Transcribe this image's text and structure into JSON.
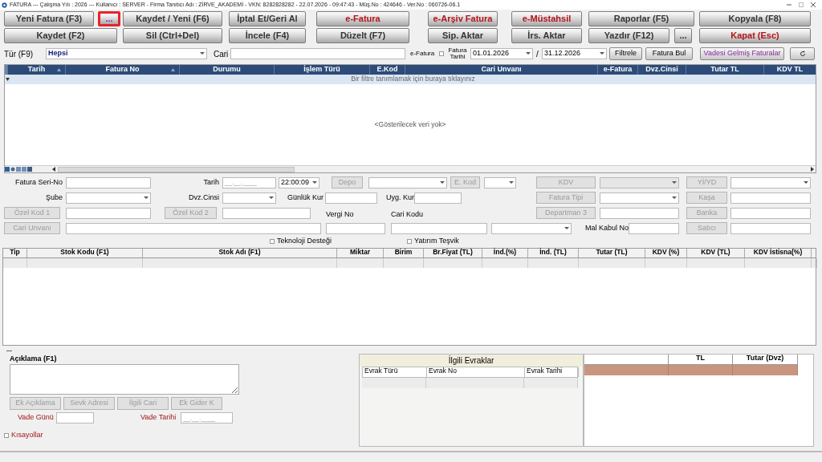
{
  "window": {
    "title": "FATURA --- Çalışma Yılı : 2026 --- Kullanıcı : SERVER - Firma Tanıtıcı Adı : ZİRVE_AKADEMİ - VKN: 8282828282 - 22.07.2026 - 09:47:43 - Müş.No : 424646 - Ver.No : 060726-06.1"
  },
  "toolbar": {
    "buttons": [
      {
        "label": "Yeni Fatura (F3)",
        "kind": "normal",
        "highlighted": false
      },
      {
        "label": "...",
        "kind": "purple",
        "highlighted": true
      },
      {
        "label": "Kaydet / Yeni (F6)",
        "kind": "normal",
        "highlighted": false
      },
      {
        "label": "İptal Et/Geri Al",
        "kind": "normal",
        "highlighted": false
      },
      {
        "label": "e-Fatura",
        "kind": "red",
        "highlighted": false
      },
      {
        "label": "e-Arşiv Fatura",
        "kind": "red",
        "highlighted": false
      },
      {
        "label": "e-Müstahsil",
        "kind": "red",
        "highlighted": false
      },
      {
        "label": "Raporlar (F5)",
        "kind": "normal",
        "highlighted": false
      },
      {
        "label": "Kopyala (F8)",
        "kind": "normal",
        "highlighted": false
      },
      {
        "label": "Kaydet (F2)",
        "kind": "normal",
        "highlighted": false
      },
      {
        "label": "Sil (Ctrl+Del)",
        "kind": "normal",
        "highlighted": false
      },
      {
        "label": "İncele (F4)",
        "kind": "normal",
        "highlighted": false
      },
      {
        "label": "Düzelt (F7)",
        "kind": "normal",
        "highlighted": false
      },
      {
        "label": "Sip. Aktar",
        "kind": "normal",
        "highlighted": false
      },
      {
        "label": "İrs. Aktar",
        "kind": "normal",
        "highlighted": false
      },
      {
        "label": "Yazdır (F12)",
        "kind": "normal",
        "highlighted": false
      },
      {
        "label": "...",
        "kind": "normal",
        "highlighted": false
      },
      {
        "label": "Kapat (Esc)",
        "kind": "red",
        "highlighted": false
      }
    ]
  },
  "filter": {
    "type_label": "Tür (F9)",
    "type_value": "Hepsi",
    "account_label": "Cari",
    "efatura": {
      "label": "e-Fatura",
      "checked": false
    },
    "date_label": "Fatura Tarihi",
    "date_from": "01.01.2026",
    "separator": "/",
    "date_to": "31.12.2026",
    "buttons": [
      {
        "label": "Filtrele",
        "kind": "normal"
      },
      {
        "label": "Fatura Bul",
        "kind": "normal"
      },
      {
        "label": "Vadesi Gelmiş Faturalar",
        "kind": "purple"
      }
    ]
  },
  "invoice_list": {
    "columns": [
      {
        "label": "Tarih",
        "sort_arrow": true
      },
      {
        "label": "Fatura No",
        "sort_arrow": true
      },
      {
        "label": "Durumu",
        "sort_arrow": false
      },
      {
        "label": "İşlem Türü",
        "sort_arrow": false
      },
      {
        "label": "E.Kod",
        "sort_arrow": false
      },
      {
        "label": "Cari Unvanı",
        "sort_arrow": false
      },
      {
        "label": "e-Fatura",
        "sort_arrow": false
      },
      {
        "label": "Dvz.Cinsi",
        "sort_arrow": false
      },
      {
        "label": "Tutar TL",
        "sort_arrow": false
      },
      {
        "label": "KDV TL",
        "sort_arrow": false
      }
    ],
    "filter_hint": "Bir filtre tanımlamak için buraya tıklayınız",
    "empty_text": "<Gösterilecek veri yok>"
  },
  "form": {
    "serial_label": "Fatura Seri-No",
    "date_label": "Tarih",
    "date_placeholder": "__.__.____",
    "time": "22:00:09",
    "branch_label": "Şube",
    "currency_label": "Dvz.Cinsi",
    "daily_rate_label": "Günlük Kur",
    "applied_rate_label": "Uyg. Kur",
    "tax_no_label": "Vergi No",
    "account_code_label": "Cari Kodu",
    "receipt_no_label": "Mal Kabul No",
    "vat_dropdown": {
      "disabled": true
    },
    "buttons": [
      {
        "label": "Depo",
        "disabled": true
      },
      {
        "label": "E. Kod",
        "disabled": true
      },
      {
        "label": "KDV",
        "disabled": true
      },
      {
        "label": "Yİ/YD",
        "disabled": true
      },
      {
        "label": "Fatura Tipi",
        "disabled": true
      },
      {
        "label": "Kaşa",
        "disabled": true
      },
      {
        "label": "Özel Kod 1",
        "disabled": true
      },
      {
        "label": "Özel Kod 2",
        "disabled": true
      },
      {
        "label": "Departman 3",
        "disabled": true
      },
      {
        "label": "Banka",
        "disabled": true
      },
      {
        "label": "Cari Unvanı",
        "disabled": true
      },
      {
        "label": "Satıcı",
        "disabled": true
      }
    ],
    "checkboxes": [
      {
        "label": "Teknoloji Desteği",
        "checked": false
      },
      {
        "label": "Yatırım Teşvik",
        "checked": false
      }
    ]
  },
  "items_table": {
    "columns": [
      "Tip",
      "Stok Kodu (F1)",
      "Stok Adı (F1)",
      "Miktar",
      "Birim",
      "Br.Fiyat (TL)",
      "İnd.(%)",
      "İnd. (TL)",
      "Tutar (TL)",
      "KDV (%)",
      "KDV (TL)",
      "KDV İstisna(%)"
    ]
  },
  "notes": {
    "label": "Açıklama (F1)",
    "buttons": [
      {
        "label": "Ek Açıklama",
        "disabled": true
      },
      {
        "label": "Sevk Adresi",
        "disabled": true
      },
      {
        "label": "İlgili Cari",
        "disabled": true
      },
      {
        "label": "Ek Gider K",
        "disabled": true
      }
    ],
    "due_days_label": "Vade Günü",
    "due_date_label": "Vade Tarihi",
    "due_date_placeholder": "__.__.____",
    "shortcuts": {
      "label": "Kısayollar",
      "checked": false
    }
  },
  "related_documents": {
    "title": "İlgili Evraklar",
    "columns": [
      "Evrak Türü",
      "Evrak No",
      "Evrak Tarihi"
    ]
  },
  "totals": {
    "columns": [
      "TL",
      "Tutar (Dvz)"
    ]
  }
}
